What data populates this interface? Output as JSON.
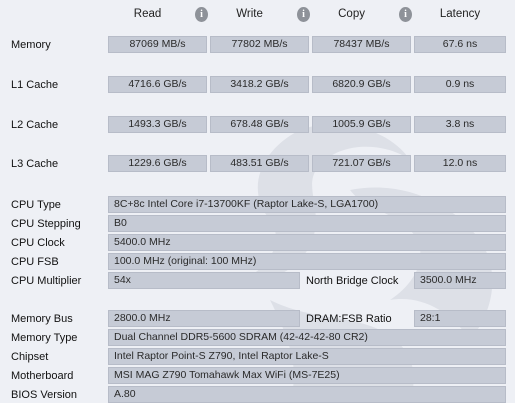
{
  "headers": {
    "read": "Read",
    "write": "Write",
    "copy": "Copy",
    "latency": "Latency",
    "info_glyph": "i"
  },
  "bench": {
    "memory": {
      "label": "Memory",
      "read": "87069 MB/s",
      "write": "77802 MB/s",
      "copy": "78437 MB/s",
      "latency": "67.6 ns"
    },
    "l1": {
      "label": "L1 Cache",
      "read": "4716.6 GB/s",
      "write": "3418.2 GB/s",
      "copy": "6820.9 GB/s",
      "latency": "0.9 ns"
    },
    "l2": {
      "label": "L2 Cache",
      "read": "1493.3 GB/s",
      "write": "678.48 GB/s",
      "copy": "1005.9 GB/s",
      "latency": "3.8 ns"
    },
    "l3": {
      "label": "L3 Cache",
      "read": "1229.6 GB/s",
      "write": "483.51 GB/s",
      "copy": "721.07 GB/s",
      "latency": "12.0 ns"
    }
  },
  "cpu": {
    "type_label": "CPU Type",
    "type": "8C+8c Intel Core i7-13700KF  (Raptor Lake-S, LGA1700)",
    "stepping_label": "CPU Stepping",
    "stepping": "B0",
    "clock_label": "CPU Clock",
    "clock": "5400.0 MHz",
    "fsb_label": "CPU FSB",
    "fsb": "100.0 MHz  (original: 100 MHz)",
    "mult_label": "CPU Multiplier",
    "mult": "54x",
    "nb_label": "North Bridge Clock",
    "nb": "3500.0 MHz"
  },
  "mem": {
    "bus_label": "Memory Bus",
    "bus": "2800.0 MHz",
    "ratio_label": "DRAM:FSB Ratio",
    "ratio": "28:1",
    "type_label": "Memory Type",
    "type": "Dual Channel DDR5-5600 SDRAM  (42-42-42-80 CR2)",
    "chipset_label": "Chipset",
    "chipset": "Intel Raptor Point-S Z790, Intel Raptor Lake-S",
    "mb_label": "Motherboard",
    "mb": "MSI MAG Z790 Tomahawk Max WiFi (MS-7E25)",
    "bios_label": "BIOS Version",
    "bios": "A.80"
  },
  "colors": {
    "background": "#eef0f5",
    "field": "#c6cbd6",
    "info_icon": "#8e9299"
  }
}
